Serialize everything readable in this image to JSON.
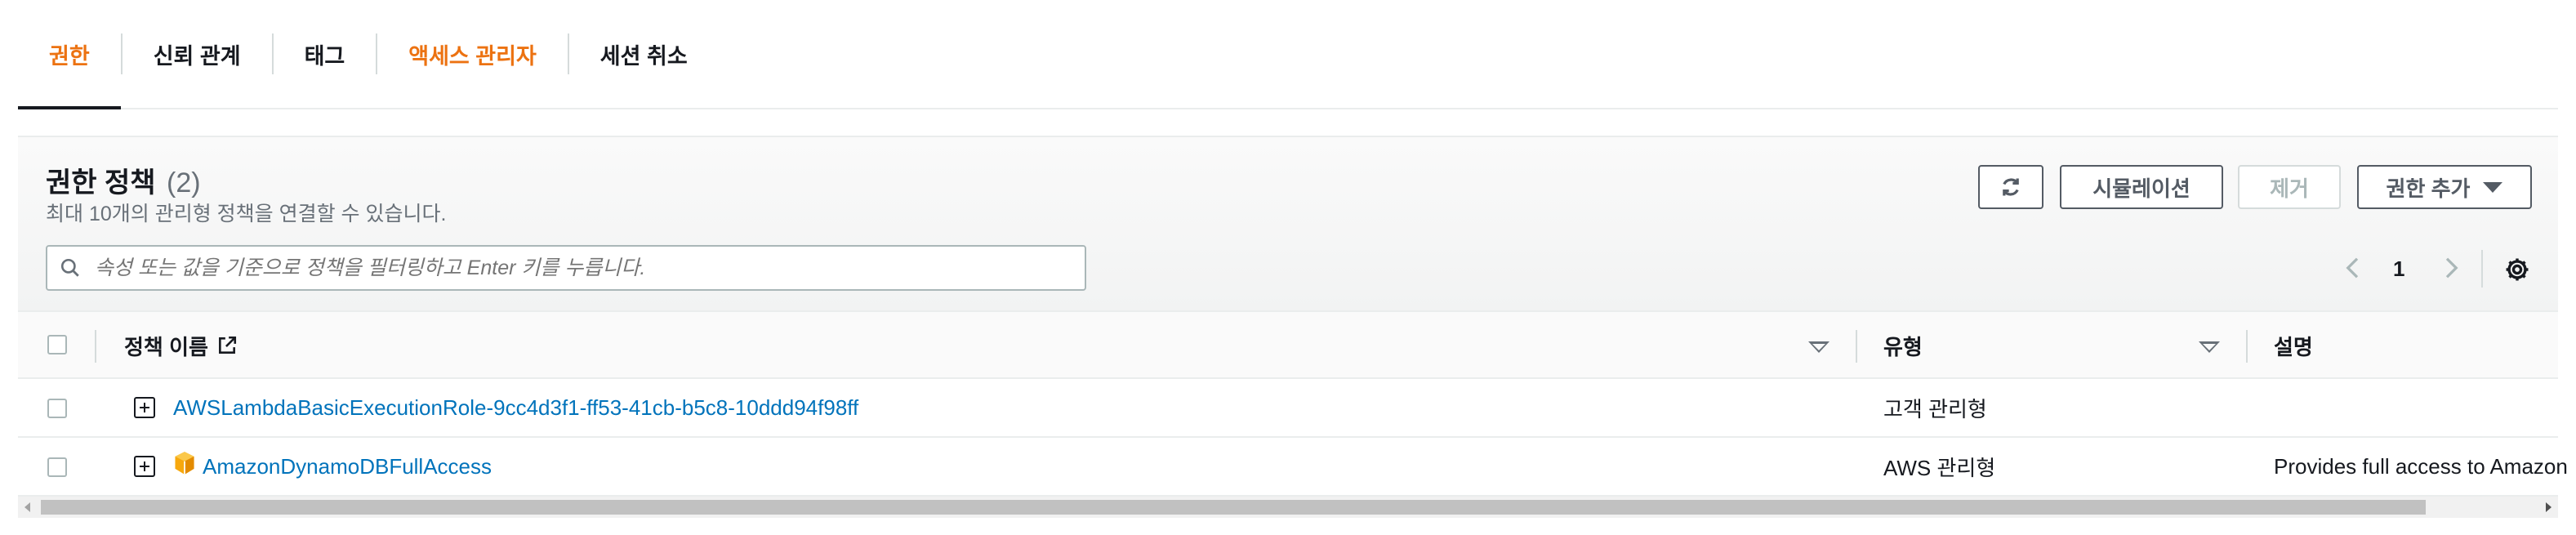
{
  "tabs": [
    {
      "label": "권한",
      "state": "active"
    },
    {
      "label": "신뢰 관계"
    },
    {
      "label": "태그"
    },
    {
      "label": "액세스 관리자",
      "color": "#ec7211"
    },
    {
      "label": "세션 취소"
    }
  ],
  "panel": {
    "title": "권한 정책",
    "count": "(2)",
    "subtitle": "최대 10개의 관리형 정책을 연결할 수 있습니다.",
    "buttons": {
      "refresh_icon": "refresh-icon",
      "simulation": "시뮬레이션",
      "remove": "제거",
      "add_permissions": "권한 추가"
    },
    "search": {
      "placeholder": "속성 또는 값을 기준으로 정책을 필터링하고 Enter 키를 누릅니다."
    },
    "pagination": {
      "current_page": "1"
    }
  },
  "table": {
    "columns": {
      "name": "정책 이름",
      "type": "유형",
      "description": "설명"
    },
    "rows": [
      {
        "name": "AWSLambdaBasicExecutionRole-9cc4d3f1-ff53-41cb-b5c8-10ddd94f98ff",
        "type": "고객 관리형",
        "description": "",
        "aws_icon": false
      },
      {
        "name": "AmazonDynamoDBFullAccess",
        "type": "AWS 관리형",
        "description": "Provides full access to Amazon",
        "aws_icon": true
      }
    ]
  },
  "colors": {
    "accent": "#ec7211",
    "link": "#0073bb",
    "text": "#16191f",
    "muted": "#687078"
  }
}
